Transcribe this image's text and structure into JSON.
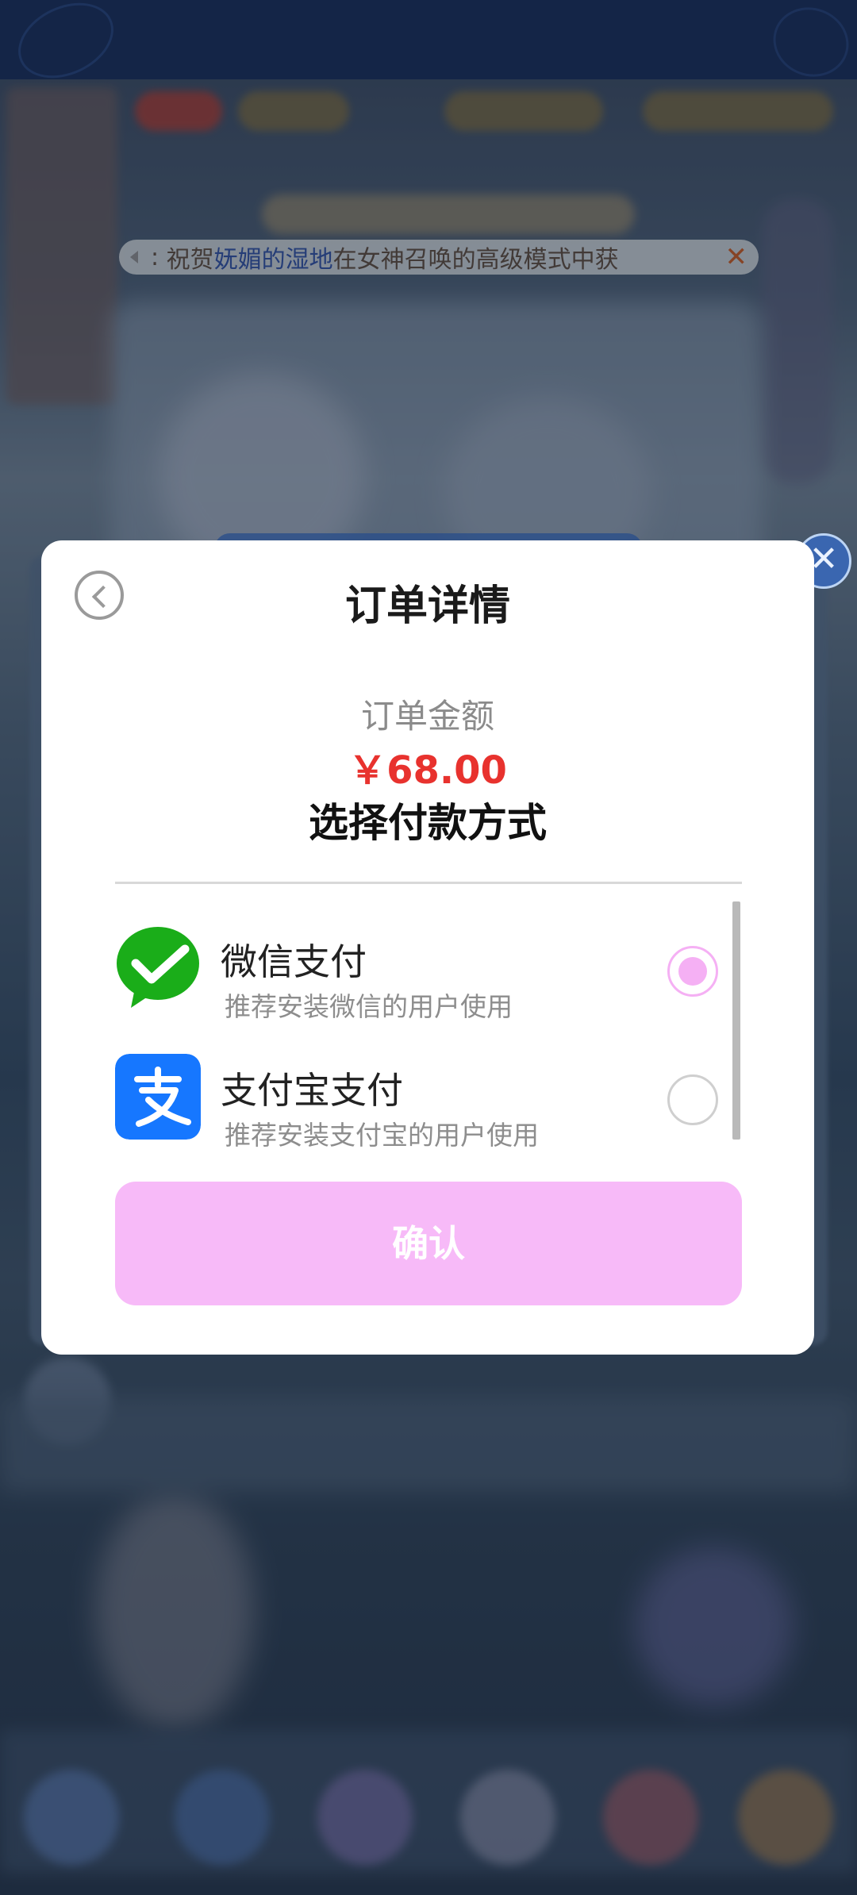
{
  "marquee": {
    "prefix": ":",
    "text_1": "祝贺",
    "player_name": "妩媚的湿地",
    "text_2": "在女神召唤的高级模式中获",
    "close_glyph": "✕"
  },
  "modal": {
    "title": "订单详情",
    "amount_label": "订单金额",
    "amount_value": "￥68.00",
    "choose_label": "选择付款方式",
    "confirm_label": "确认"
  },
  "payment_methods": [
    {
      "name": "微信支付",
      "subtitle": "推荐安装微信的用户使用",
      "icon": "wechat-pay-icon",
      "selected": true
    },
    {
      "name": "支付宝支付",
      "subtitle": "推荐安装支付宝的用户使用",
      "icon": "alipay-icon",
      "selected": false
    }
  ],
  "background": {
    "close_glyph": "✕"
  },
  "colors": {
    "accent_pink": "#f5b0f4",
    "price_red": "#e8322e",
    "wechat_green": "#1aad19",
    "alipay_blue": "#1677ff"
  }
}
